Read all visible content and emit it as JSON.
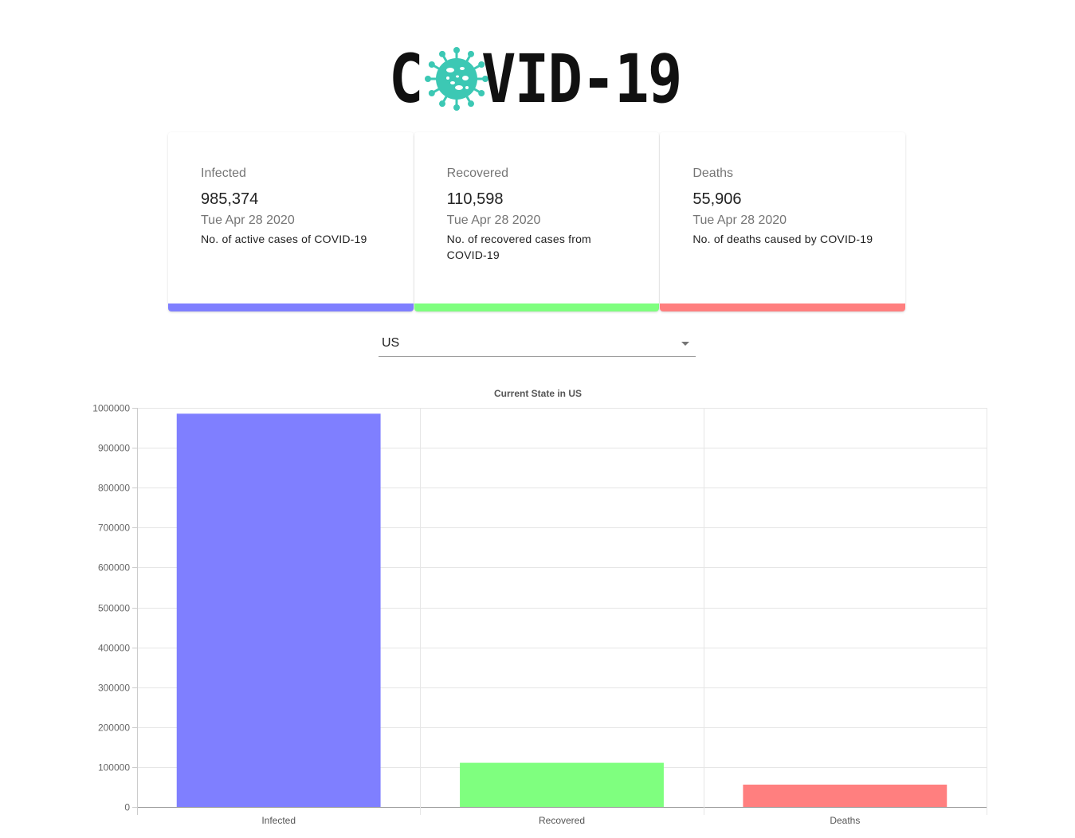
{
  "logo": {
    "text_before": "C",
    "text_after": "VID-19",
    "virus_color": "#3cc8b4"
  },
  "cards": [
    {
      "title": "Infected",
      "value": "985,374",
      "date": "Tue Apr 28 2020",
      "description": "No. of active cases of COVID-19",
      "color": "#7f7fff"
    },
    {
      "title": "Recovered",
      "value": "110,598",
      "date": "Tue Apr 28 2020",
      "description": "No. of recovered cases from COVID-19",
      "color": "#7fff7f"
    },
    {
      "title": "Deaths",
      "value": "55,906",
      "date": "Tue Apr 28 2020",
      "description": "No. of deaths caused by COVID-19",
      "color": "#ff7f7f"
    }
  ],
  "country_select": {
    "selected": "US"
  },
  "chart_data": {
    "type": "bar",
    "title": "Current State in US",
    "categories": [
      "Infected",
      "Recovered",
      "Deaths"
    ],
    "values": [
      985374,
      110598,
      55906
    ],
    "colors": [
      "#7f7fff",
      "#7fff7f",
      "#ff7f7f"
    ],
    "ylim": [
      0,
      1000000
    ],
    "yticks": [
      0,
      100000,
      200000,
      300000,
      400000,
      500000,
      600000,
      700000,
      800000,
      900000,
      1000000
    ],
    "grid": true,
    "legend": "none"
  }
}
